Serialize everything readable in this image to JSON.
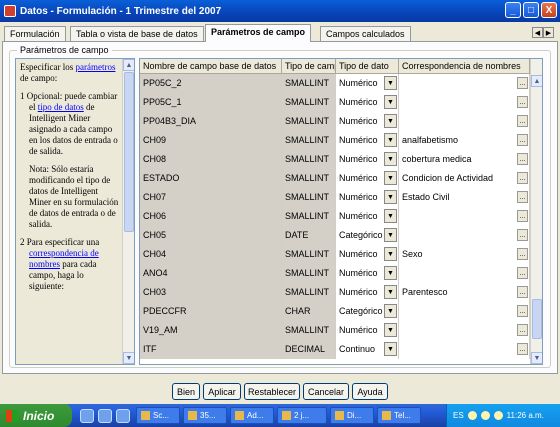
{
  "window": {
    "title": "Datos - Formulación - 1 Trimestre del 2007",
    "minimize": "_",
    "maximize": "□",
    "close": "X"
  },
  "tabs": [
    {
      "label": "Formulación"
    },
    {
      "label": "Tabla o vista de base de datos"
    },
    {
      "label": "Parámetros de campo"
    },
    {
      "label": "Campos calculados"
    }
  ],
  "active_tab": "Parámetros de campo",
  "group_title": "Parámetros de campo",
  "help": {
    "p1a": "Especificar los ",
    "p1link": "parámetros",
    "p1b": " de campo:",
    "item1a": "1  Opcional: puede cambiar el ",
    "item1link": "tipo de datos",
    "item1b": " de Intelligent Miner asignado a cada campo en los datos de entrada o de salida.",
    "note": "Nota: Sólo estaría modificando el tipo de datos de Intelligent Miner en su formulación de datos de entrada o de salida.",
    "item2a": "2  Para especificar una ",
    "item2link": "correspondencia de nombres",
    "item2b": " para cada campo, haga lo siguiente:"
  },
  "grid": {
    "headers": [
      "Nombre de campo base de datos",
      "Tipo de campo b",
      "Tipo de dato",
      "Correspondencia de nombres"
    ],
    "rows": [
      {
        "name": "PP05C_2",
        "ftype": "SMALLINT",
        "dtype": "Numérico",
        "map": ""
      },
      {
        "name": "PP05C_1",
        "ftype": "SMALLINT",
        "dtype": "Numérico",
        "map": ""
      },
      {
        "name": "PP04B3_DIA",
        "ftype": "SMALLINT",
        "dtype": "Numérico",
        "map": ""
      },
      {
        "name": "CH09",
        "ftype": "SMALLINT",
        "dtype": "Numérico",
        "map": "analfabetismo"
      },
      {
        "name": "CH08",
        "ftype": "SMALLINT",
        "dtype": "Numérico",
        "map": "cobertura medica"
      },
      {
        "name": "ESTADO",
        "ftype": "SMALLINT",
        "dtype": "Numérico",
        "map": "Condicion de Actividad"
      },
      {
        "name": "CH07",
        "ftype": "SMALLINT",
        "dtype": "Numérico",
        "map": "Estado Civil"
      },
      {
        "name": "CH06",
        "ftype": "SMALLINT",
        "dtype": "Numérico",
        "map": ""
      },
      {
        "name": "CH05",
        "ftype": "DATE",
        "dtype": "Categórico",
        "map": ""
      },
      {
        "name": "CH04",
        "ftype": "SMALLINT",
        "dtype": "Numérico",
        "map": "Sexo"
      },
      {
        "name": "ANO4",
        "ftype": "SMALLINT",
        "dtype": "Numérico",
        "map": ""
      },
      {
        "name": "CH03",
        "ftype": "SMALLINT",
        "dtype": "Numérico",
        "map": "Parentesco"
      },
      {
        "name": "PDECCFR",
        "ftype": "CHAR",
        "dtype": "Categórico",
        "map": ""
      },
      {
        "name": "V19_AM",
        "ftype": "SMALLINT",
        "dtype": "Numérico",
        "map": ""
      },
      {
        "name": "ITF",
        "ftype": "DECIMAL",
        "dtype": "Continuo",
        "map": ""
      }
    ]
  },
  "buttons": {
    "ok": "Bien",
    "apply": "Aplicar",
    "reset": "Restablecer",
    "cancel": "Cancelar",
    "help": "Ayuda"
  },
  "taskbar": {
    "start": "Inicio",
    "tasks": [
      "Sc...",
      "35...",
      "Ad...",
      "2 j...",
      "Di...",
      "Tel..."
    ],
    "lang": "ES",
    "clock": "11:26 a.m."
  },
  "colors": {
    "title_bar": "#0a5fd8",
    "start_button": "#3c9a3c",
    "link": "#0000ff"
  }
}
